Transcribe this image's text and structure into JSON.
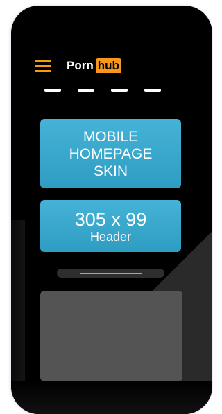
{
  "logo": {
    "part1": "Porn",
    "part2": "hub"
  },
  "skin_card": {
    "lines": [
      "MOBILE",
      "HOMEPAGE",
      "SKIN"
    ]
  },
  "header_card": {
    "size": "305 x 99",
    "label": "Header"
  },
  "colors": {
    "accent": "#f7971d",
    "card": "#3aa8cc",
    "placeholder": "#545454"
  }
}
